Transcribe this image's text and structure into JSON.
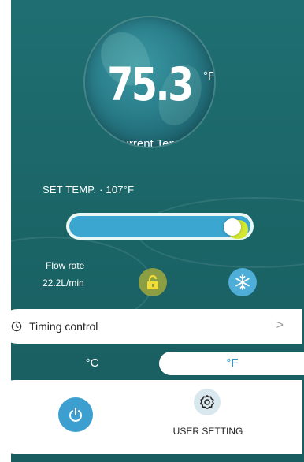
{
  "thermo": {
    "temperature": "75.3",
    "unit": "°F",
    "caption": "Current Temp"
  },
  "set_temp": {
    "text": "SET TEMP. · 107°F"
  },
  "slider": {
    "level": 0.9
  },
  "flow": {
    "label": "Flow rate",
    "value": "22.2L/min"
  },
  "icons": {
    "lock": "unlock-icon",
    "snow": "snowflake-icon",
    "clock": "clock-icon",
    "chevron": "chevron-right-icon",
    "power": "power-icon",
    "gear": "gear-icon"
  },
  "timing": {
    "label": "Timing control",
    "chevron": ">"
  },
  "units": {
    "celsius": "°C",
    "fahrenheit": "°F"
  },
  "bottom": {
    "user_setting": "USER SETTING"
  },
  "colors": {
    "background": "#1f6f72",
    "accent_blue": "#3ba6cf",
    "lock_green": "#8b9e43",
    "snow_blue": "#4eaed7"
  }
}
